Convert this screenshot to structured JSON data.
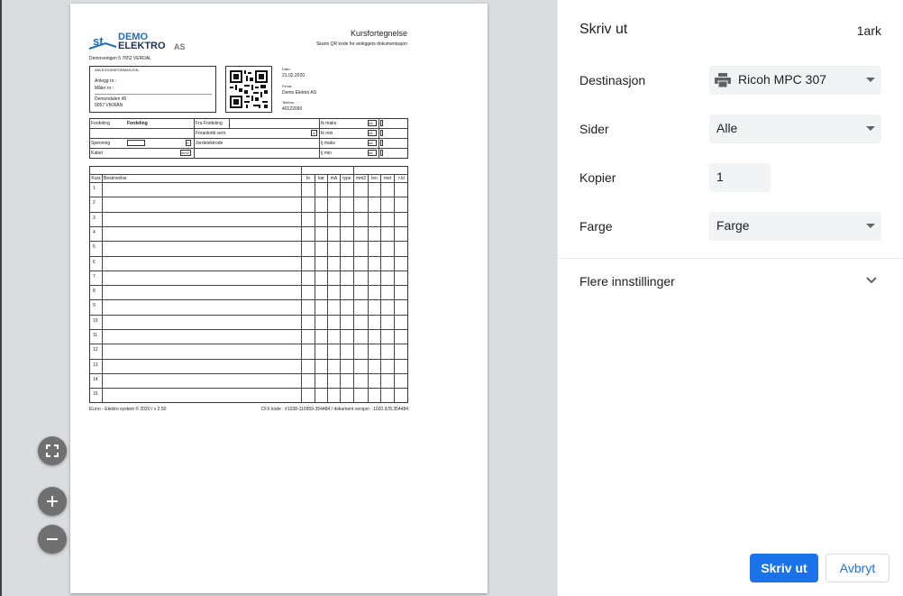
{
  "panel": {
    "title": "Skriv ut",
    "sheet_count": "1ark",
    "destination": {
      "label": "Destinasjon",
      "value": "Ricoh MPC 307",
      "icon": "printer-icon"
    },
    "pages": {
      "label": "Sider",
      "value": "Alle"
    },
    "copies": {
      "label": "Kopier",
      "value": "1"
    },
    "color": {
      "label": "Farge",
      "value": "Farge"
    },
    "more_settings": "Flere innstillinger",
    "print_button": "Skriv ut",
    "cancel_button": "Avbryt",
    "accent": "#1a73e8"
  },
  "preview": {
    "fit_icon": "fullscreen-icon",
    "zoom_in_icon": "plus-icon",
    "zoom_out_icon": "minus-icon"
  },
  "doc": {
    "logo_line1": "DEMO",
    "logo_line2": "ELEKTRO",
    "logo_suffix": "AS",
    "title": "Kursfortegnelse",
    "subtitle": "Skann QR kode for anleggets dokumentasjon",
    "address": "Demoveingen 5 7652 VERDAL",
    "info_header": "ANLEGGSINFORMASJON",
    "anlegg": "Anlegg nr :",
    "maler": "Måler nr :",
    "street": "Demondalen 45",
    "city": "9057 VIKRAN",
    "dato_label": "Dato:",
    "dato": "21.02.2020",
    "firma_label": "Firma:",
    "firma": "Demo Elektro AS",
    "tlf_label": "Telefon:",
    "tlf": "40122000",
    "fordeling": "Fordeling",
    "fordeling_val": "Fordeling",
    "fra_fordeling": "Fra Fordeling",
    "forankobl": "Forankobl.vern",
    "spenning": "Spenning",
    "kabel": "Kabel",
    "jordelektrode": "Jordelektrode",
    "ik_maks": "Ik maks",
    "ik_min": "Ik min",
    "tj_maks": "Ij maks",
    "tj_min": "Ij min",
    "unit_ka": "kA",
    "unit_a": "A",
    "unit_v": "V",
    "unit_mm2": "mm2",
    "vern": "Vern",
    "kabel_head": "Kabel",
    "cols": [
      "Kurs",
      "Beskrivelse",
      "In",
      "kar",
      "mA",
      "type",
      "mm2",
      "len",
      "met",
      "r.kl"
    ],
    "rows": [
      "1",
      "2",
      "3",
      "4",
      "5",
      "6",
      "7",
      "8",
      "9",
      "10",
      "11",
      "12",
      "13",
      "14",
      "15"
    ],
    "footer_left": "ELinn - Elektro system © 2020 / v 2.50",
    "footer_right": "CFX kode : #1038-110959-354484 / dokument versjon : 1020.978.354484"
  }
}
